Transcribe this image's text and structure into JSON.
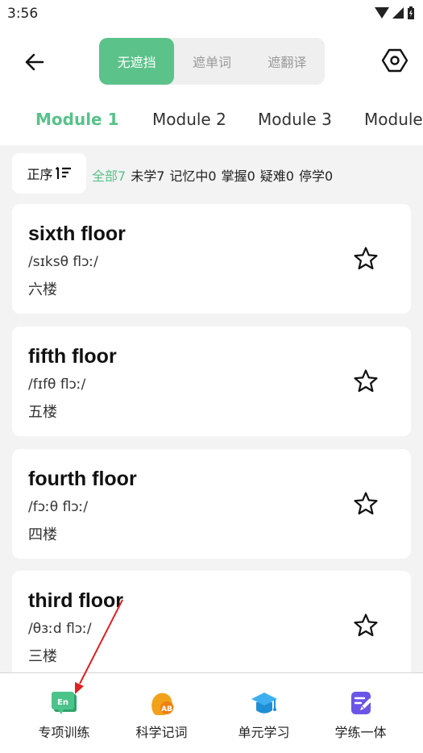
{
  "status": {
    "time": "3:56"
  },
  "header": {
    "segments": [
      "无遮挡",
      "遮单词",
      "遮翻译"
    ],
    "active_segment": 0
  },
  "modules": [
    "Module 1",
    "Module 2",
    "Module 3",
    "Module"
  ],
  "filters": {
    "sort_label": "正序",
    "chips": [
      "全部7",
      "未学7",
      "记忆中0",
      "掌握0",
      "疑难0",
      "停学0"
    ]
  },
  "words": [
    {
      "word": "sixth floor",
      "phonetic": "/sɪksθ flɔː/",
      "translation": "六楼"
    },
    {
      "word": "fifth floor",
      "phonetic": "/fɪfθ flɔː/",
      "translation": "五楼"
    },
    {
      "word": "fourth floor",
      "phonetic": "/fɔːθ flɔː/",
      "translation": "四楼"
    },
    {
      "word": "third floor",
      "phonetic": "/θɜːd flɔː/",
      "translation": "三楼"
    }
  ],
  "bottom_nav": [
    {
      "label": "专项训练",
      "icon": "en-card-icon"
    },
    {
      "label": "科学记词",
      "icon": "head-ab-icon"
    },
    {
      "label": "单元学习",
      "icon": "graduation-cap-icon"
    },
    {
      "label": "学练一体",
      "icon": "edit-doc-icon"
    }
  ],
  "colors": {
    "accent": "#58c28b",
    "annotation": "#e02020"
  }
}
